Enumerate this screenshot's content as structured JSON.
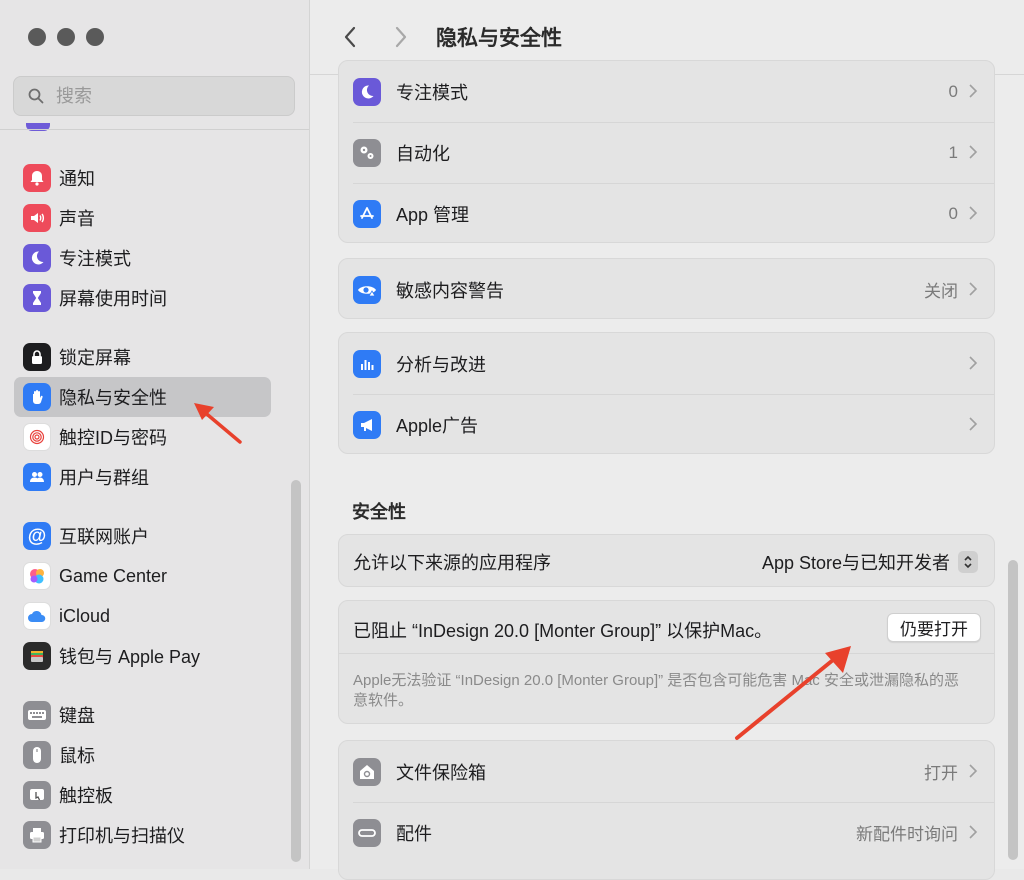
{
  "window": {
    "title": "隐私与安全性"
  },
  "search": {
    "placeholder": "搜索"
  },
  "sidebar": {
    "items": [
      {
        "label": "通知",
        "icon": "bell-icon",
        "color": "#ee4b5b"
      },
      {
        "label": "声音",
        "icon": "speaker-icon",
        "color": "#ee4b5b"
      },
      {
        "label": "专注模式",
        "icon": "moon-icon",
        "color": "#6a59d8"
      },
      {
        "label": "屏幕使用时间",
        "icon": "hourglass-icon",
        "color": "#6a59d8"
      },
      {
        "label": "锁定屏幕",
        "icon": "lock-icon",
        "color": "#1d1d1f"
      },
      {
        "label": "隐私与安全性",
        "icon": "hand-icon",
        "color": "#2f7bf5"
      },
      {
        "label": "触控ID与密码",
        "icon": "fingerprint-icon",
        "color": "#ffffff"
      },
      {
        "label": "用户与群组",
        "icon": "users-icon",
        "color": "#2f7bf5"
      },
      {
        "label": "互联网账户",
        "icon": "at-icon",
        "color": "#2f7bf5"
      },
      {
        "label": "Game Center",
        "icon": "game-center-icon",
        "color": "#ffffff"
      },
      {
        "label": "iCloud",
        "icon": "cloud-icon",
        "color": "#ffffff"
      },
      {
        "label": "钱包与 Apple Pay",
        "icon": "wallet-icon",
        "color": "#2b2b2b"
      },
      {
        "label": "键盘",
        "icon": "keyboard-icon",
        "color": "#8e8e93"
      },
      {
        "label": "鼠标",
        "icon": "mouse-icon",
        "color": "#8e8e93"
      },
      {
        "label": "触控板",
        "icon": "trackpad-icon",
        "color": "#8e8e93"
      },
      {
        "label": "打印机与扫描仪",
        "icon": "printer-icon",
        "color": "#8e8e93"
      }
    ]
  },
  "main": {
    "group1": [
      {
        "label": "专注模式",
        "value": "0",
        "icon": "moon-icon",
        "color": "#6a59d8"
      },
      {
        "label": "自动化",
        "value": "1",
        "icon": "gears-icon",
        "color": "#8e8e93"
      },
      {
        "label": "App 管理",
        "value": "0",
        "icon": "app-store-icon",
        "color": "#2f7bf5"
      }
    ],
    "group2": [
      {
        "label": "敏感内容警告",
        "value": "关闭",
        "icon": "eye-warning-icon",
        "color": "#2f7bf5"
      }
    ],
    "group3": [
      {
        "label": "分析与改进",
        "value": "",
        "icon": "chart-icon",
        "color": "#2f7bf5"
      },
      {
        "label": "Apple广告",
        "value": "",
        "icon": "megaphone-icon",
        "color": "#2f7bf5"
      }
    ],
    "security": {
      "title": "安全性",
      "allow_label": "允许以下来源的应用程序",
      "allow_value": "App Store与已知开发者",
      "blocked_text": "已阻止 “InDesign 20.0 [Monter Group]” 以保护Mac。",
      "open_button": "仍要打开",
      "blocked_desc": "Apple无法验证 “InDesign 20.0 [Monter Group]” 是否包含可能危害 Mac 安全或泄漏隐私的恶意软件。"
    },
    "group4": [
      {
        "label": "文件保险箱",
        "value": "打开",
        "icon": "filevault-icon",
        "color": "#8e8e93"
      },
      {
        "label": "配件",
        "value": "新配件时询问",
        "icon": "accessory-icon",
        "color": "#8e8e93"
      }
    ]
  },
  "colors": {
    "accent": "#2f7bf5",
    "annotation_arrow": "#e8412c"
  }
}
